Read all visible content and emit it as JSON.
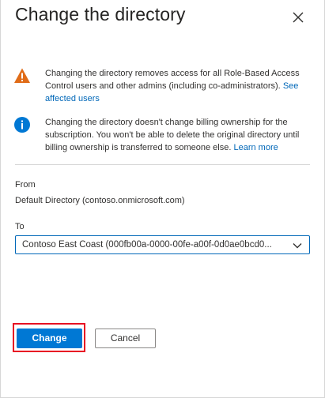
{
  "panel": {
    "title": "Change the directory"
  },
  "notices": {
    "warning": {
      "text": "Changing the directory removes access for all Role-Based Access Control users and other admins (including co-administrators). ",
      "link": "See affected users",
      "icon": "warning-icon",
      "color": "#d83b01"
    },
    "info": {
      "text": "Changing the directory doesn't change billing ownership for the subscription. You won't be able to delete the original directory until billing ownership is transferred to someone else. ",
      "link": "Learn more",
      "icon": "info-icon",
      "color": "#0078d4"
    }
  },
  "form": {
    "from_label": "From",
    "from_value": "Default Directory (contoso.onmicrosoft.com)",
    "to_label": "To",
    "to_value": "Contoso East Coast (000fb00a-0000-00fe-a00f-0d0ae0bcd0..."
  },
  "actions": {
    "change_label": "Change",
    "cancel_label": "Cancel"
  },
  "colors": {
    "accent": "#0078d4",
    "highlight": "#e81123"
  }
}
